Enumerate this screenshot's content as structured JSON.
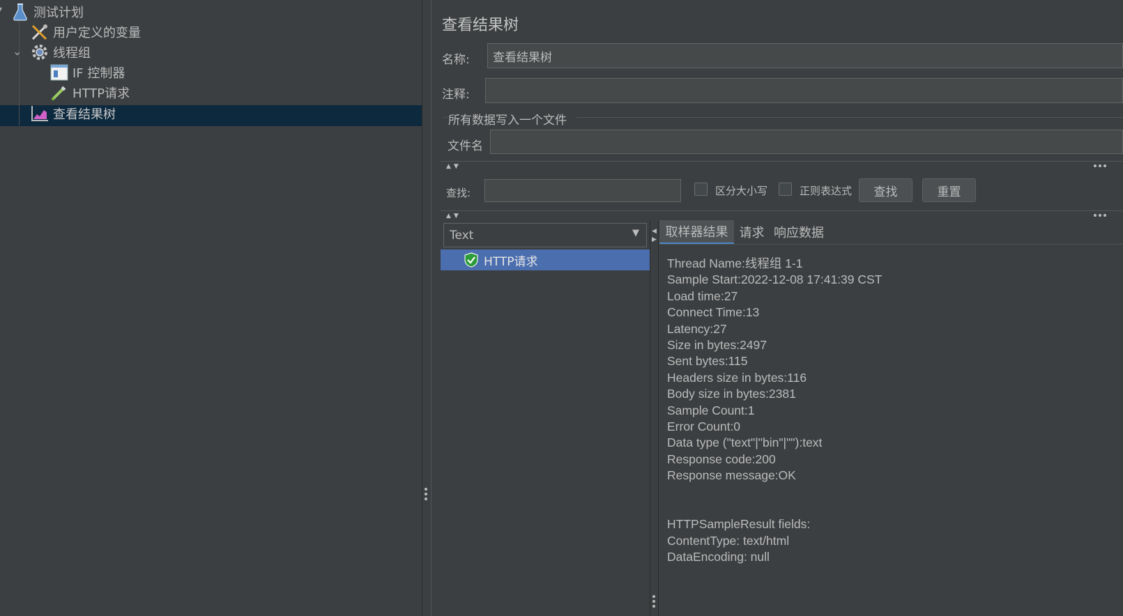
{
  "tree": {
    "items": [
      {
        "label": "测试计划",
        "icon": "flask-icon"
      },
      {
        "label": "用户定义的变量",
        "icon": "tools-icon"
      },
      {
        "label": "线程组",
        "icon": "gear-icon"
      },
      {
        "label": "IF 控制器",
        "icon": "if-controller-icon"
      },
      {
        "label": "HTTP请求",
        "icon": "pipette-icon"
      },
      {
        "label": "查看结果树",
        "icon": "chart-icon"
      }
    ]
  },
  "panel": {
    "title": "查看结果树",
    "name_label": "名称:",
    "name_value": "查看结果树",
    "comment_label": "注释:",
    "comment_value": "",
    "file_group_label": "所有数据写入一个文件",
    "filename_label": "文件名",
    "filename_value": ""
  },
  "search": {
    "label": "查找:",
    "value": "",
    "case_label": "区分大小写",
    "regex_label": "正则表达式",
    "find_button": "查找",
    "reset_button": "重置"
  },
  "renderer": {
    "selected": "Text"
  },
  "results": {
    "items": [
      {
        "label": "HTTP请求",
        "status": "success"
      }
    ]
  },
  "tabs": [
    "取样器结果",
    "请求",
    "响应数据"
  ],
  "sampler_result": {
    "lines": [
      "Thread Name:线程组 1-1",
      "Sample Start:2022-12-08 17:41:39 CST",
      "Load time:27",
      "Connect Time:13",
      "Latency:27",
      "Size in bytes:2497",
      "Sent bytes:115",
      "Headers size in bytes:116",
      "Body size in bytes:2381",
      "Sample Count:1",
      "Error Count:0",
      "Data type (\"text\"|\"bin\"|\"\"):text",
      "Response code:200",
      "Response message:OK",
      "",
      "",
      "HTTPSampleResult fields:",
      "ContentType: text/html",
      "DataEncoding: null"
    ]
  },
  "colors": {
    "background": "#3c3f41",
    "selection_tree": "#0d293e",
    "selection_list": "#4b6eaf",
    "text": "#bbbbbb"
  }
}
